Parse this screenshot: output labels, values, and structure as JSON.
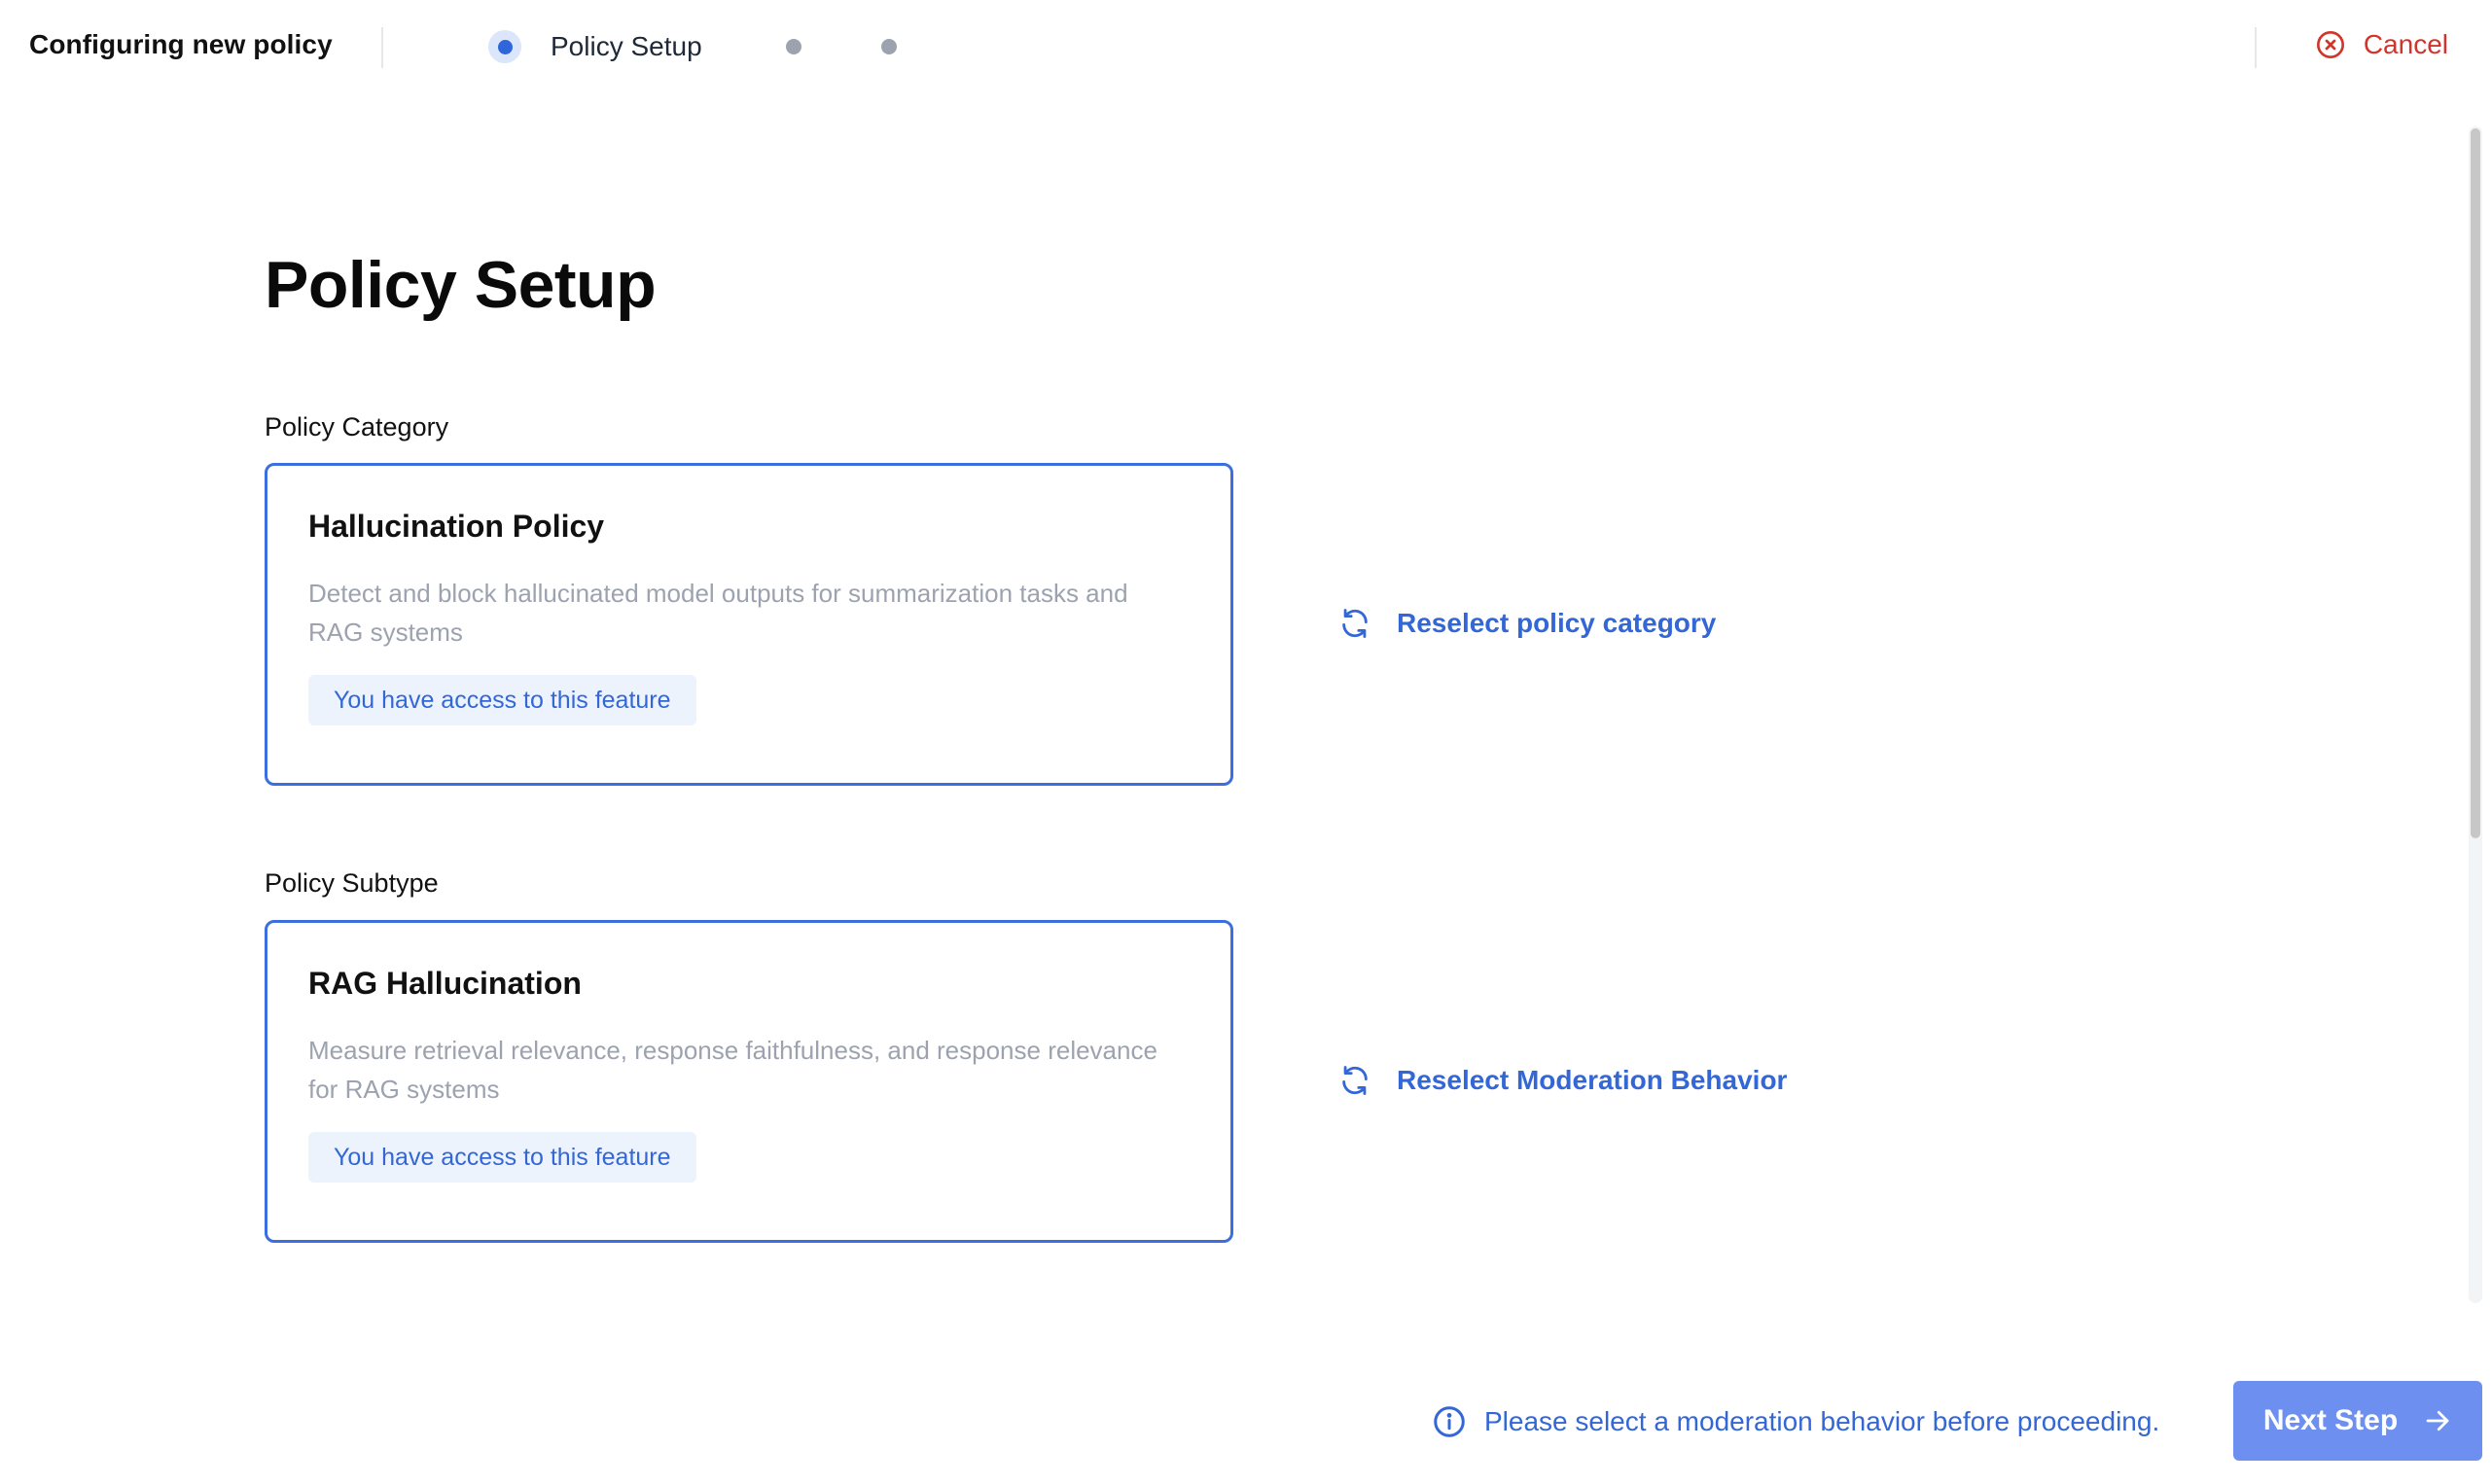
{
  "header": {
    "title": "Configuring new policy",
    "steps": [
      {
        "label": "Policy Setup",
        "state": "active"
      },
      {
        "label": "",
        "state": "pending"
      },
      {
        "label": "",
        "state": "pending"
      }
    ],
    "cancel_label": "Cancel",
    "cancel_icon": "x-circle-icon"
  },
  "main": {
    "title": "Policy Setup",
    "category": {
      "section_label": "Policy Category",
      "card_title": "Hallucination Policy",
      "card_description": "Detect and block hallucinated model outputs for summarization tasks and RAG systems",
      "badge": "You have access to this feature",
      "reselect_label": "Reselect policy category",
      "reselect_icon": "refresh-icon"
    },
    "subtype": {
      "section_label": "Policy Subtype",
      "card_title": "RAG Hallucination",
      "card_description": "Measure retrieval relevance, response faithfulness, and response relevance for RAG systems",
      "badge": "You have access to this feature",
      "reselect_label": "Reselect Moderation Behavior",
      "reselect_icon": "refresh-icon"
    }
  },
  "footer": {
    "notice_text": "Please select a moderation behavior before proceeding.",
    "notice_icon": "info-icon",
    "next_label": "Next Step",
    "next_icon": "arrow-right-icon"
  },
  "colors": {
    "accent": "#3b6fe0",
    "link": "#3467d6",
    "danger": "#d2342b",
    "button_disabled": "#6c8ff0",
    "badge_bg": "#edf3fd",
    "muted_text": "#9ca3af"
  }
}
